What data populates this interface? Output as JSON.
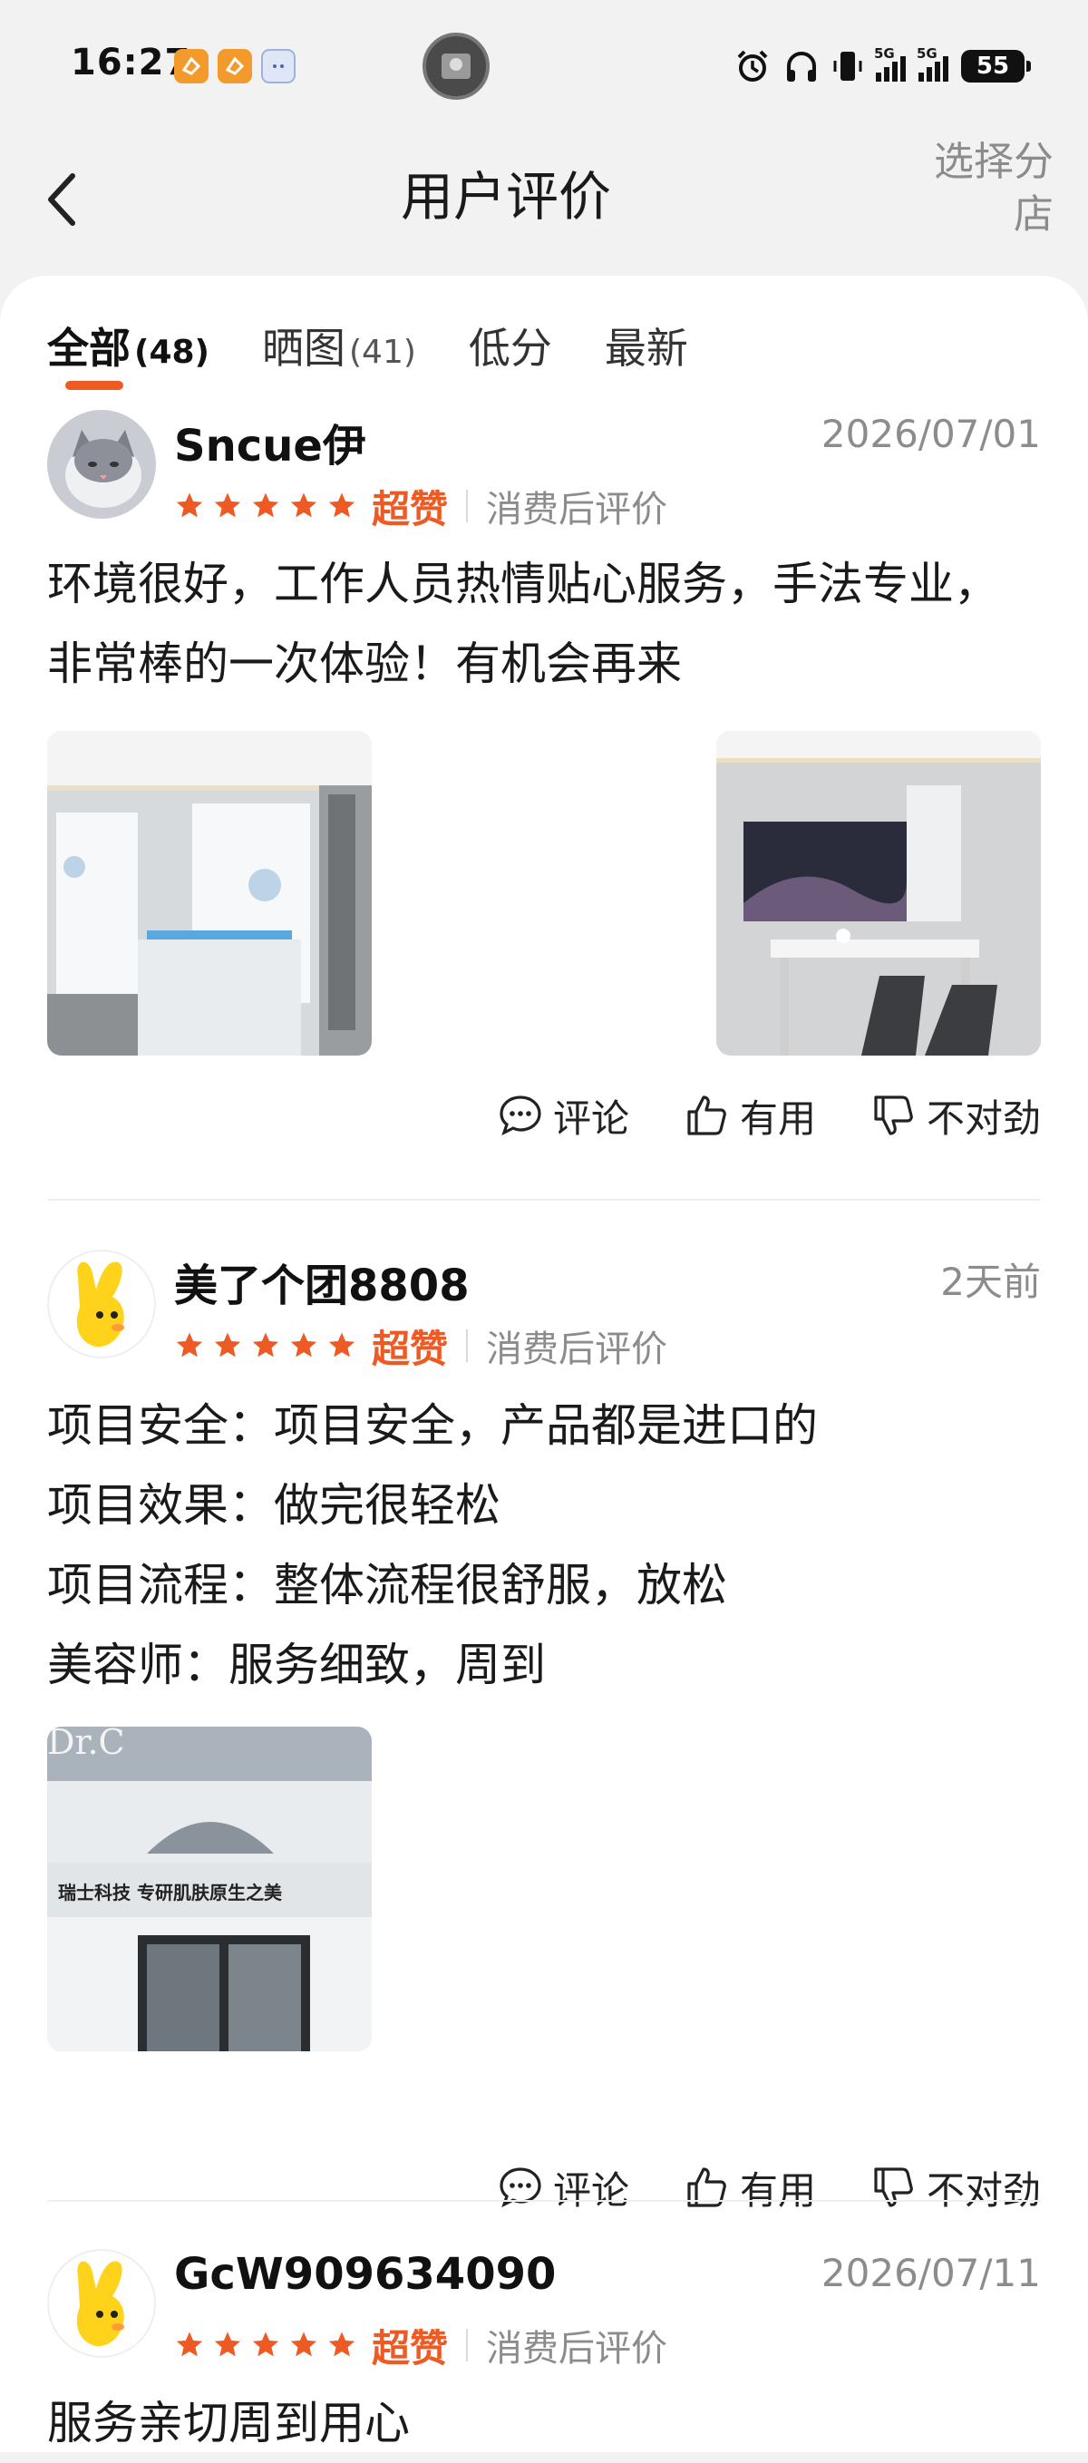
{
  "status_bar": {
    "time": "16:27",
    "battery": "55",
    "net1": "5G",
    "net2": "5G"
  },
  "header": {
    "title": "用户评价",
    "shop_select": "选择分店"
  },
  "tabs": [
    {
      "label": "全部",
      "count": "(48)"
    },
    {
      "label": "晒图",
      "count": "(41)"
    },
    {
      "label": "低分",
      "count": ""
    },
    {
      "label": "最新",
      "count": ""
    }
  ],
  "reviews": [
    {
      "user": "Sncue伊",
      "date": "2026/07/01",
      "stars": 5,
      "badge": "超赞",
      "tag": "消费后评价",
      "lines": [
        "环境很好，工作人员热情贴心服务，手法专业，",
        "非常棒的一次体验！有机会再来"
      ],
      "actions": {
        "comment": "评论",
        "useful": "有用",
        "wrong": "不对劲"
      }
    },
    {
      "user": "美了个团8808",
      "date": "2天前",
      "stars": 5,
      "badge": "超赞",
      "tag": "消费后评价",
      "lines": [
        "项目安全：项目安全，产品都是进口的",
        "项目效果：做完很轻松",
        "项目流程：整体流程很舒服，放松",
        "美容师：服务细致，周到"
      ],
      "photo_sign_text": "瑞士科技 专研肌肤原生之美",
      "photo_top_text": "Dr.C",
      "actions": {
        "comment": "评论",
        "useful": "有用",
        "wrong": "不对劲"
      }
    },
    {
      "user": "GcW909634090",
      "date": "2026/07/11",
      "stars": 5,
      "badge": "超赞",
      "tag": "消费后评价",
      "lines": [
        "服务亲切周到用心"
      ]
    }
  ],
  "colors": {
    "accent": "#ee5a24",
    "muted": "#8c8c8c"
  }
}
